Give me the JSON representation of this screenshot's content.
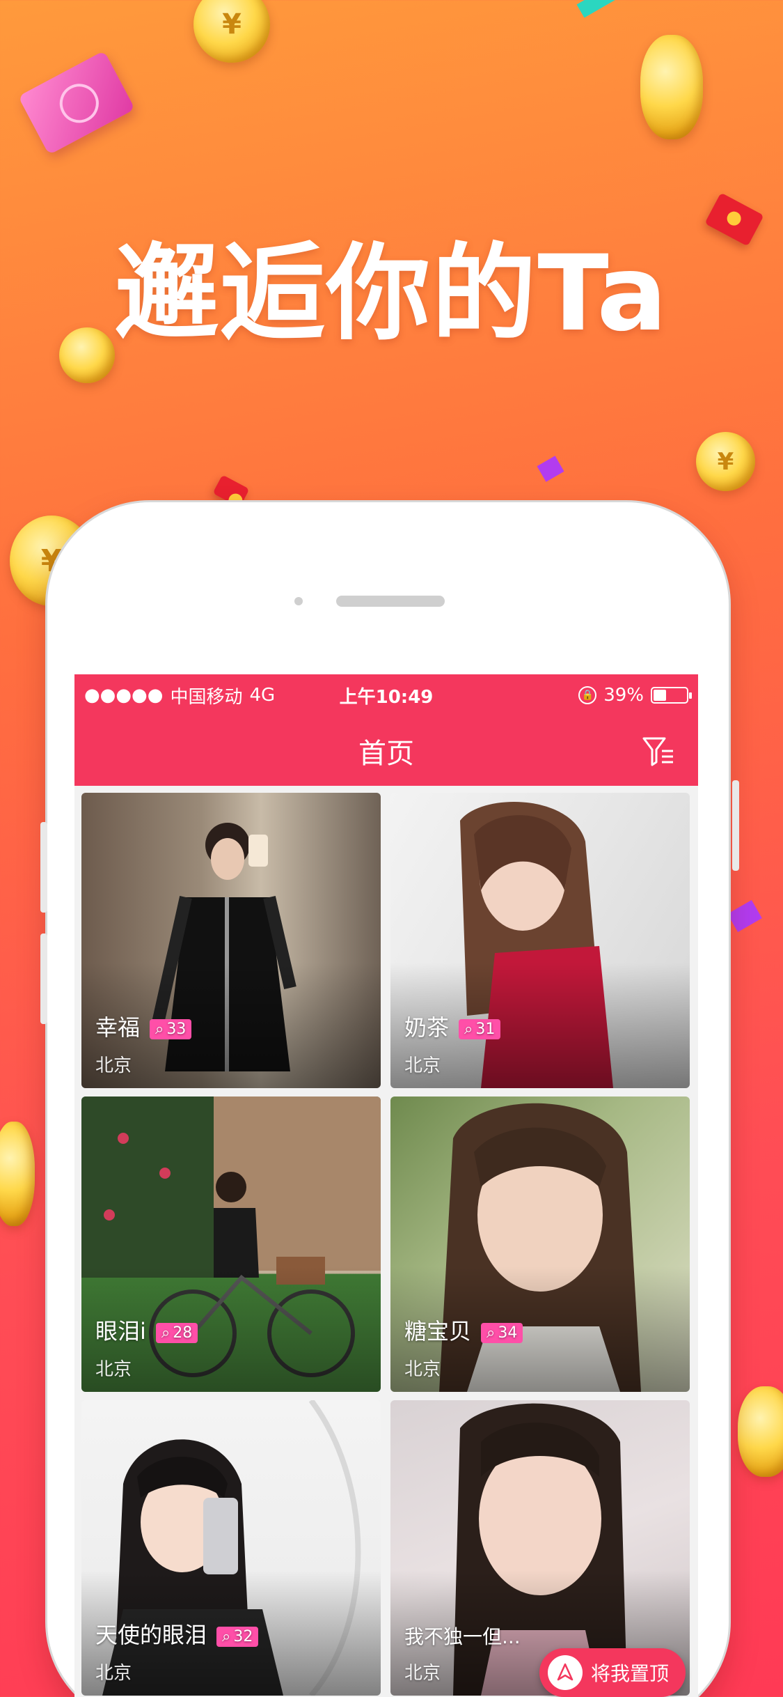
{
  "headline": "邂逅你的Ta",
  "status_bar": {
    "signal": "●●●●●",
    "carrier": "中国移动",
    "network": "4G",
    "time": "上午10:49",
    "battery": "39%",
    "battery_level": 0.39
  },
  "nav": {
    "title": "首页",
    "filter_icon": "filter-icon"
  },
  "cards": [
    {
      "name": "幸福",
      "count": "33",
      "city": "北京"
    },
    {
      "name": "奶茶",
      "count": "31",
      "city": "北京"
    },
    {
      "name": "眼泪i",
      "count": "28",
      "city": "北京"
    },
    {
      "name": "糖宝贝",
      "count": "34",
      "city": "北京"
    },
    {
      "name": "天使的眼泪",
      "count": "32",
      "city": "北京"
    },
    {
      "name": "我不独一但...",
      "count": "",
      "city": "北京"
    }
  ],
  "to_top": {
    "label": "将我置顶"
  },
  "colors": {
    "accent": "#f4375d",
    "badge": "#ff4fa8"
  },
  "decorations": {
    "coin_symbol": "¥"
  }
}
